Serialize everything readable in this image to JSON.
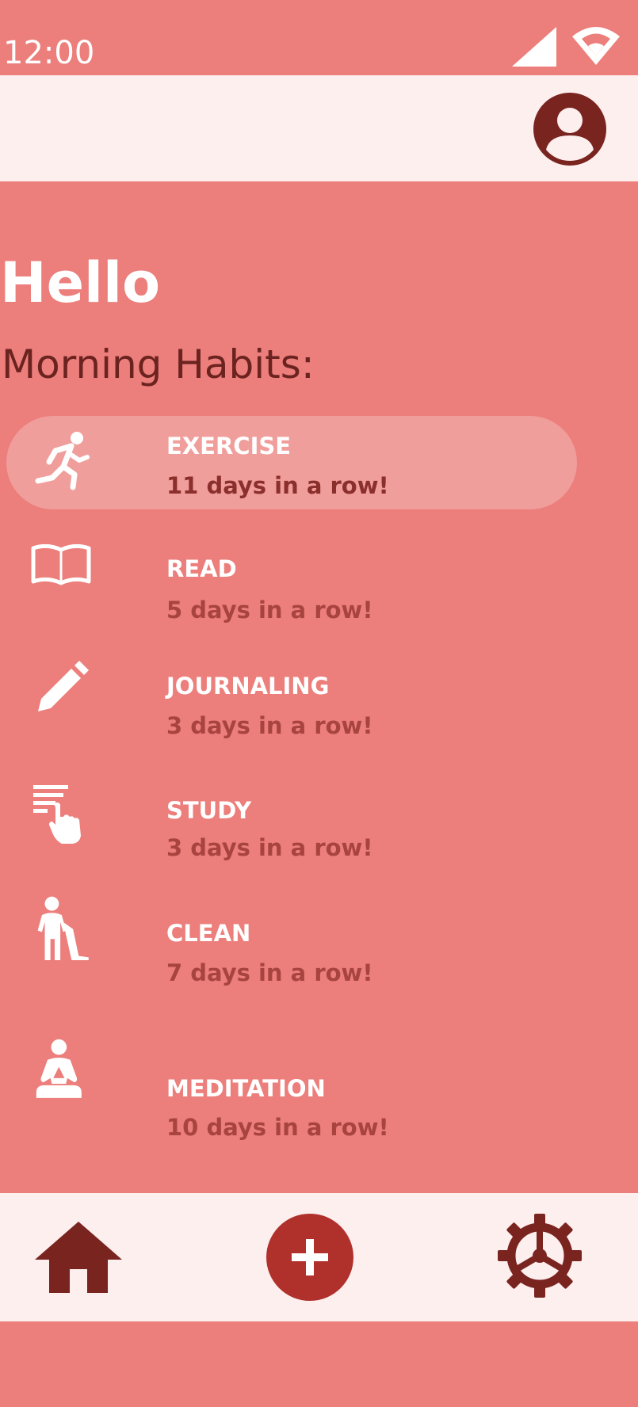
{
  "status_bar": {
    "time": "12:00"
  },
  "header": {
    "avatar_icon": "account-circle-icon"
  },
  "greeting": "Hello",
  "section_title": "Morning Habits:",
  "habits": [
    {
      "name": "EXERCISE",
      "streak": "11 days in a row!",
      "icon": "running-icon",
      "selected": true
    },
    {
      "name": "READ",
      "streak": "5 days in a row!",
      "icon": "book-icon",
      "selected": false
    },
    {
      "name": "JOURNALING",
      "streak": "3 days in a row!",
      "icon": "pencil-icon",
      "selected": false
    },
    {
      "name": "STUDY",
      "streak": "3 days in a row!",
      "icon": "document-touch-icon",
      "selected": false
    },
    {
      "name": "CLEAN",
      "streak": "7 days in a row!",
      "icon": "cleaning-person-icon",
      "selected": false
    },
    {
      "name": "MEDITATION",
      "streak": "10 days in a row!",
      "icon": "meditation-icon",
      "selected": false
    }
  ],
  "bottom_nav": {
    "items": [
      "home-icon",
      "add-icon",
      "settings-icon"
    ]
  },
  "colors": {
    "background": "#ec7e7b",
    "surface": "#fcefee",
    "selected_item": "#f09e9b",
    "accent_dark": "#7a2420",
    "accent_button": "#b0312c",
    "streak_text": "#a84440"
  }
}
